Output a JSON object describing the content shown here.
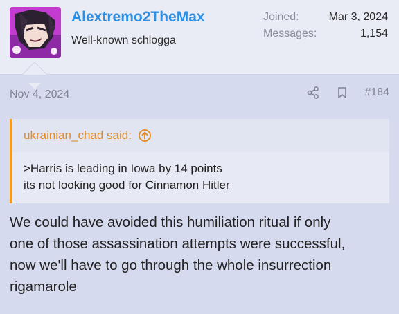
{
  "user": {
    "username": "Alextremo2TheMax",
    "title": "Well-known schlogga",
    "joined_label": "Joined:",
    "joined_value": "Mar 3, 2024",
    "messages_label": "Messages:",
    "messages_value": "1,154"
  },
  "post": {
    "date": "Nov 4, 2024",
    "number": "#184",
    "icons": [
      "share-icon",
      "bookmark-icon"
    ],
    "quote": {
      "author": "ukrainian_chad said:",
      "lines": [
        ">Harris is leading in Iowa by 14 points",
        "its not looking good for Cinnamon Hitler"
      ]
    },
    "message_lines": [
      "We could have avoided this humiliation ritual if only",
      "one of those assassination attempts were successful,",
      "now we'll have to go through the whole insurrection",
      "rigamarole"
    ]
  },
  "colors": {
    "username": "#2f8ee0",
    "quote_accent": "#f29b1d",
    "background": "#d6daee"
  }
}
